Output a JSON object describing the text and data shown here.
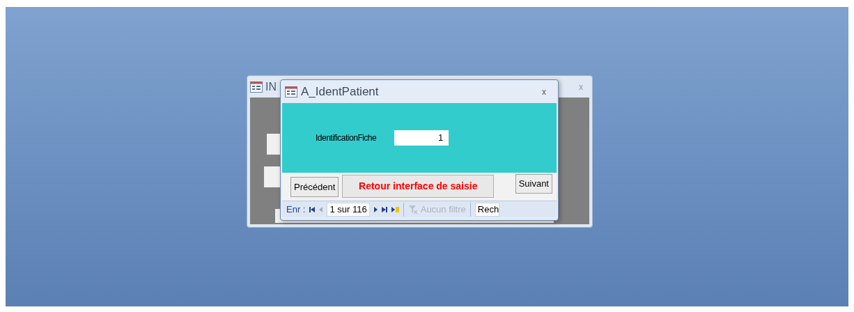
{
  "back_window": {
    "title": "IN",
    "close": "x"
  },
  "dialog": {
    "title": "A_IdentPatient",
    "close": "x",
    "field": {
      "label": "IdentificationFiche",
      "value": "1"
    },
    "buttons": {
      "previous": "Précédent",
      "return": "Retour interface de saisie",
      "next": "Suivant"
    },
    "nav": {
      "label": "Enr :",
      "position": "1 sur 116",
      "filter": "Aucun filtre",
      "filter_disabled": true,
      "search": "Rech"
    }
  }
}
